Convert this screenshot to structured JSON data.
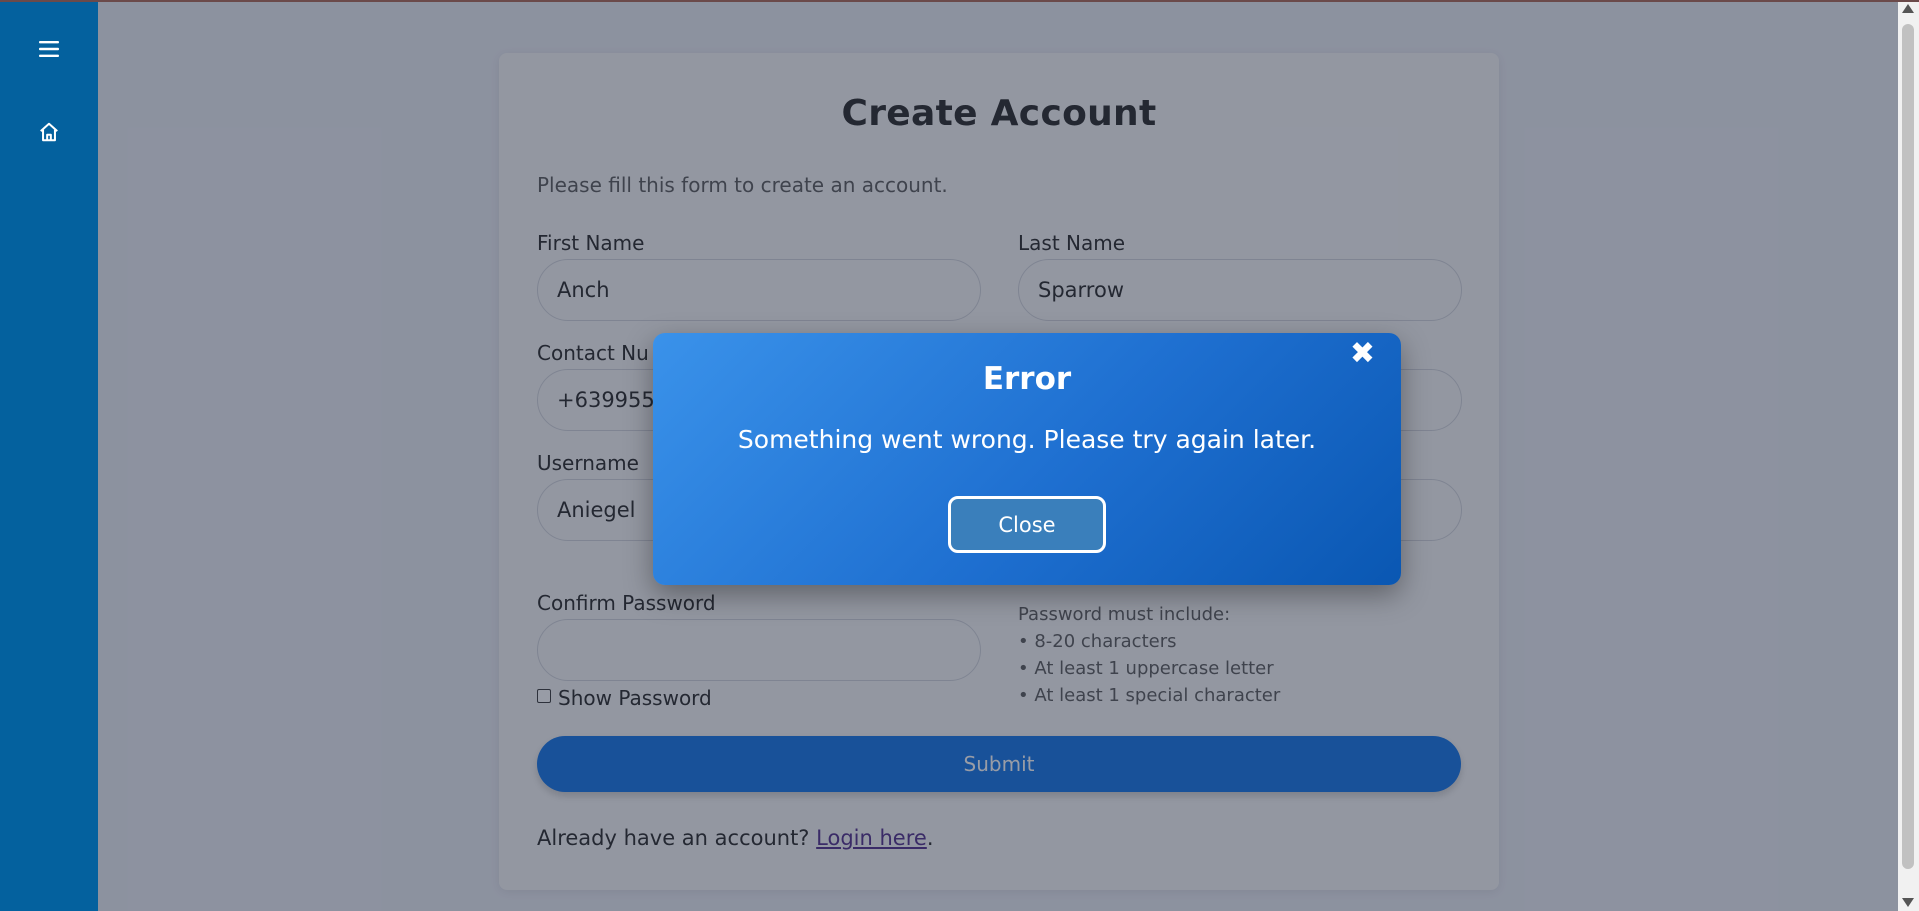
{
  "sidebar": {
    "icons": [
      "hamburger-menu-icon",
      "home-icon"
    ],
    "background": "#04619e"
  },
  "form": {
    "title": "Create Account",
    "subtitle": "Please fill this form to create an account.",
    "first_name": {
      "label": "First Name",
      "value": "Anch"
    },
    "last_name": {
      "label": "Last Name",
      "value": "Sparrow"
    },
    "contact": {
      "label": "Contact Nu",
      "value": "+6399555"
    },
    "username": {
      "label": "Username",
      "value": "Aniegel"
    },
    "confirm_password": {
      "label": "Confirm Password",
      "value": ""
    },
    "show_password": {
      "label": "Show Password",
      "checked": false
    },
    "password_rules": {
      "heading": "Password must include:",
      "items": [
        "• 8-20 characters",
        "• At least 1 uppercase letter",
        "• At least 1 special character"
      ]
    },
    "submit_label": "Submit",
    "login_prompt": "Already have an account?",
    "login_link": "Login here",
    "login_suffix": "."
  },
  "modal": {
    "title": "Error",
    "message": "Something went wrong. Please try again later.",
    "close_icon": "close-x-icon",
    "close_symbol": "✖",
    "close_label": "Close"
  },
  "colors": {
    "accent": "#0a6fe6",
    "modal_start": "#3a92ea",
    "modal_end": "#0a57b2"
  }
}
